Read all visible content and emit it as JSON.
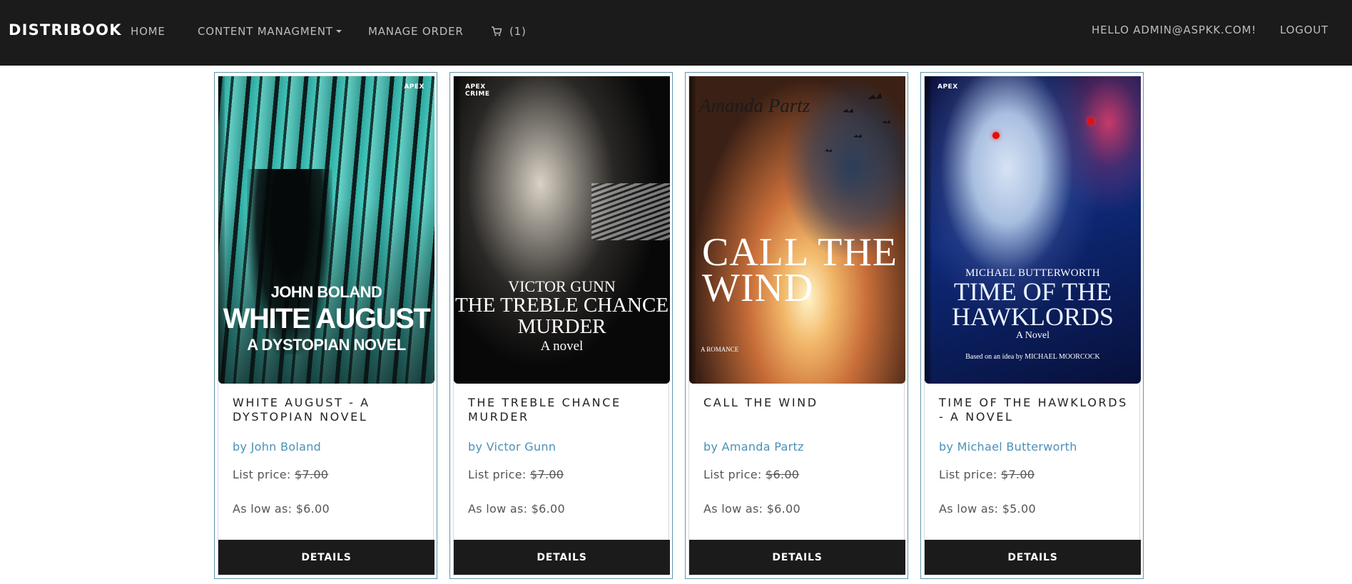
{
  "navbar": {
    "brand": "DISTRIBOOK",
    "home": "HOME",
    "content_management": "CONTENT MANAGMENT",
    "manage_order": "MANAGE ORDER",
    "cart_count": "(1)",
    "cart_icon": "cart-icon",
    "greeting": "HELLO ADMIN@ASPKK.COM!",
    "logout": "LOGOUT"
  },
  "books": [
    {
      "cover": {
        "publisher": "APEX",
        "author": "JOHN BOLAND",
        "title": "WHITE AUGUST",
        "subtitle": "A DYSTOPIAN NOVEL"
      },
      "title": "WHITE AUGUST - A DYSTOPIAN NOVEL",
      "author": "by John Boland",
      "list_price_label": "List price:",
      "list_price": "$7.00",
      "low_price": "As low as: $6.00",
      "details": "DETAILS"
    },
    {
      "cover": {
        "publisher": "APEX CRIME",
        "author": "VICTOR GUNN",
        "title": "THE TREBLE CHANCE MURDER",
        "subtitle": "A novel"
      },
      "title": "THE TREBLE CHANCE MURDER",
      "author": "by Victor Gunn",
      "list_price_label": "List price:",
      "list_price": "$7.00",
      "low_price": "As low as: $6.00",
      "details": "DETAILS"
    },
    {
      "cover": {
        "publisher": "",
        "author": "Amanda Partz",
        "title": "CALL THE WIND",
        "subtitle": "A ROMANCE"
      },
      "title": "CALL THE WIND",
      "author": "by Amanda Partz",
      "list_price_label": "List price:",
      "list_price": "$6.00",
      "low_price": "As low as: $6.00",
      "details": "DETAILS"
    },
    {
      "cover": {
        "publisher": "APEX",
        "author": "MICHAEL BUTTERWORTH",
        "title": "TIME OF THE HAWKLORDS",
        "subtitle": "A Novel",
        "note": "Based on an idea by MICHAEL MOORCOCK"
      },
      "title": "TIME OF THE HAWKLORDS - A NOVEL",
      "author": "by Michael Butterworth",
      "list_price_label": "List price:",
      "list_price": "$7.00",
      "low_price": "As low as: $5.00",
      "details": "DETAILS"
    }
  ]
}
